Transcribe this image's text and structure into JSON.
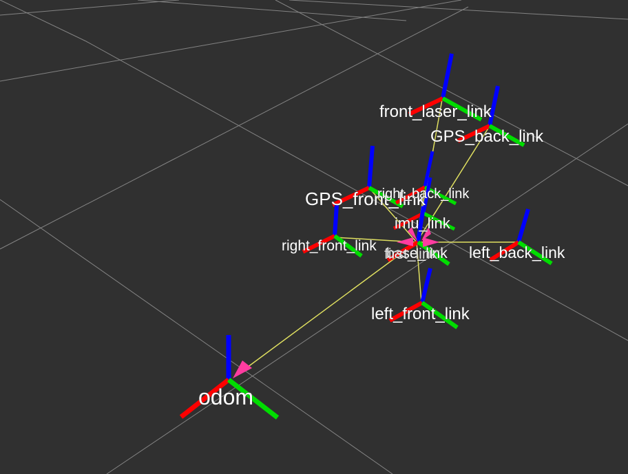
{
  "view": {
    "background": "#303030",
    "grid_color": "#a0a0a0",
    "axis_colors": {
      "x": "#ff0000",
      "y": "#00dd00",
      "z": "#0000ff"
    },
    "link_color": "#e0e060",
    "arrow_color": "#ff3ca0"
  },
  "frames": [
    {
      "id": "odom",
      "label": "odom"
    },
    {
      "id": "base_link",
      "label": "base_link"
    },
    {
      "id": "front_laser_link",
      "label": "front_laser_link"
    },
    {
      "id": "GPS_back_link",
      "label": "GPS_back_link"
    },
    {
      "id": "GPS_front_link",
      "label": "GPS_front_link"
    },
    {
      "id": "right_back_link",
      "label": "right_back_link"
    },
    {
      "id": "imu_link",
      "label": "imu_link"
    },
    {
      "id": "right_front_link",
      "label": "right_front_link"
    },
    {
      "id": "left_back_link",
      "label": "left_back_link"
    },
    {
      "id": "left_front_link",
      "label": "left_front_link"
    },
    {
      "id": "first_link",
      "label": "first_link"
    }
  ]
}
